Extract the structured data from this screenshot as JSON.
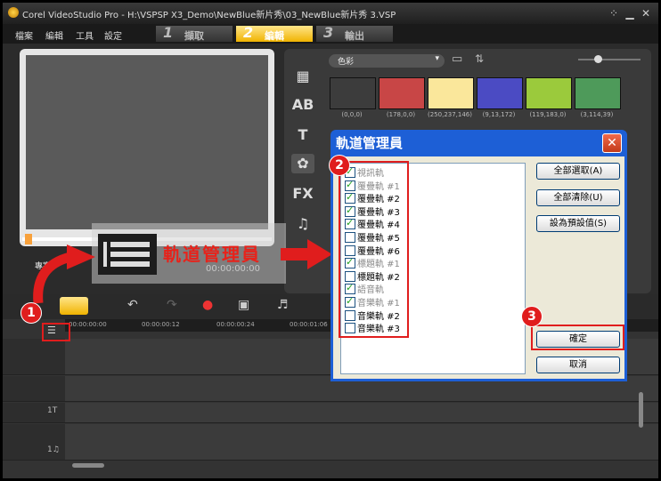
{
  "app": {
    "title": "Corel VideoStudio Pro - H:\\VSPSP X3_Demo\\NewBlue新片秀\\03_NewBlue新片秀 3.VSP",
    "menus": [
      "檔案",
      "編輯",
      "工具",
      "設定"
    ],
    "steps": [
      {
        "num": "1",
        "label": "擷取"
      },
      {
        "num": "2",
        "label": "編輯"
      },
      {
        "num": "3",
        "label": "輸出"
      }
    ]
  },
  "library": {
    "category": "色彩",
    "swatches": [
      {
        "color": "#3c3c3c",
        "label": "(0,0,0)"
      },
      {
        "color": "#c84646",
        "label": "(178,0,0)"
      },
      {
        "color": "#fae79b",
        "label": "(250,237,146)"
      },
      {
        "color": "#4b4bc3",
        "label": "(9,13,172)"
      },
      {
        "color": "#9bca3c",
        "label": "(119,183,0)"
      },
      {
        "color": "#4e9a5a",
        "label": "(3,114,39)"
      }
    ]
  },
  "preview": {
    "project_label": "專案",
    "timecode": "00:00:00:00"
  },
  "timeline": {
    "ruler": [
      "00:00:00:00",
      "00:00:00:12",
      "00:00:00:24",
      "00:00:01:06"
    ],
    "track_labels": [
      "1T",
      "1♫"
    ]
  },
  "callout": {
    "text": "軌道管理員"
  },
  "badges": [
    "1",
    "2",
    "3"
  ],
  "dialog": {
    "title": "軌道管理員",
    "tracks": [
      {
        "label": "視訊軌",
        "checked": true,
        "dim": true
      },
      {
        "label": "覆疊軌 #1",
        "checked": true,
        "dim": true
      },
      {
        "label": "覆疊軌 #2",
        "checked": true,
        "dim": false
      },
      {
        "label": "覆疊軌 #3",
        "checked": true,
        "dim": false
      },
      {
        "label": "覆疊軌 #4",
        "checked": true,
        "dim": false
      },
      {
        "label": "覆疊軌 #5",
        "checked": false,
        "dim": false
      },
      {
        "label": "覆疊軌 #6",
        "checked": false,
        "dim": false
      },
      {
        "label": "標題軌 #1",
        "checked": true,
        "dim": true
      },
      {
        "label": "標題軌 #2",
        "checked": false,
        "dim": false
      },
      {
        "label": "語音軌",
        "checked": true,
        "dim": true
      },
      {
        "label": "音樂軌 #1",
        "checked": true,
        "dim": true
      },
      {
        "label": "音樂軌 #2",
        "checked": false,
        "dim": false
      },
      {
        "label": "音樂軌 #3",
        "checked": false,
        "dim": false
      }
    ],
    "select_all": "全部選取(A)",
    "clear_all": "全部清除(U)",
    "set_default": "設為預設值(S)",
    "ok": "確定",
    "cancel": "取消"
  }
}
